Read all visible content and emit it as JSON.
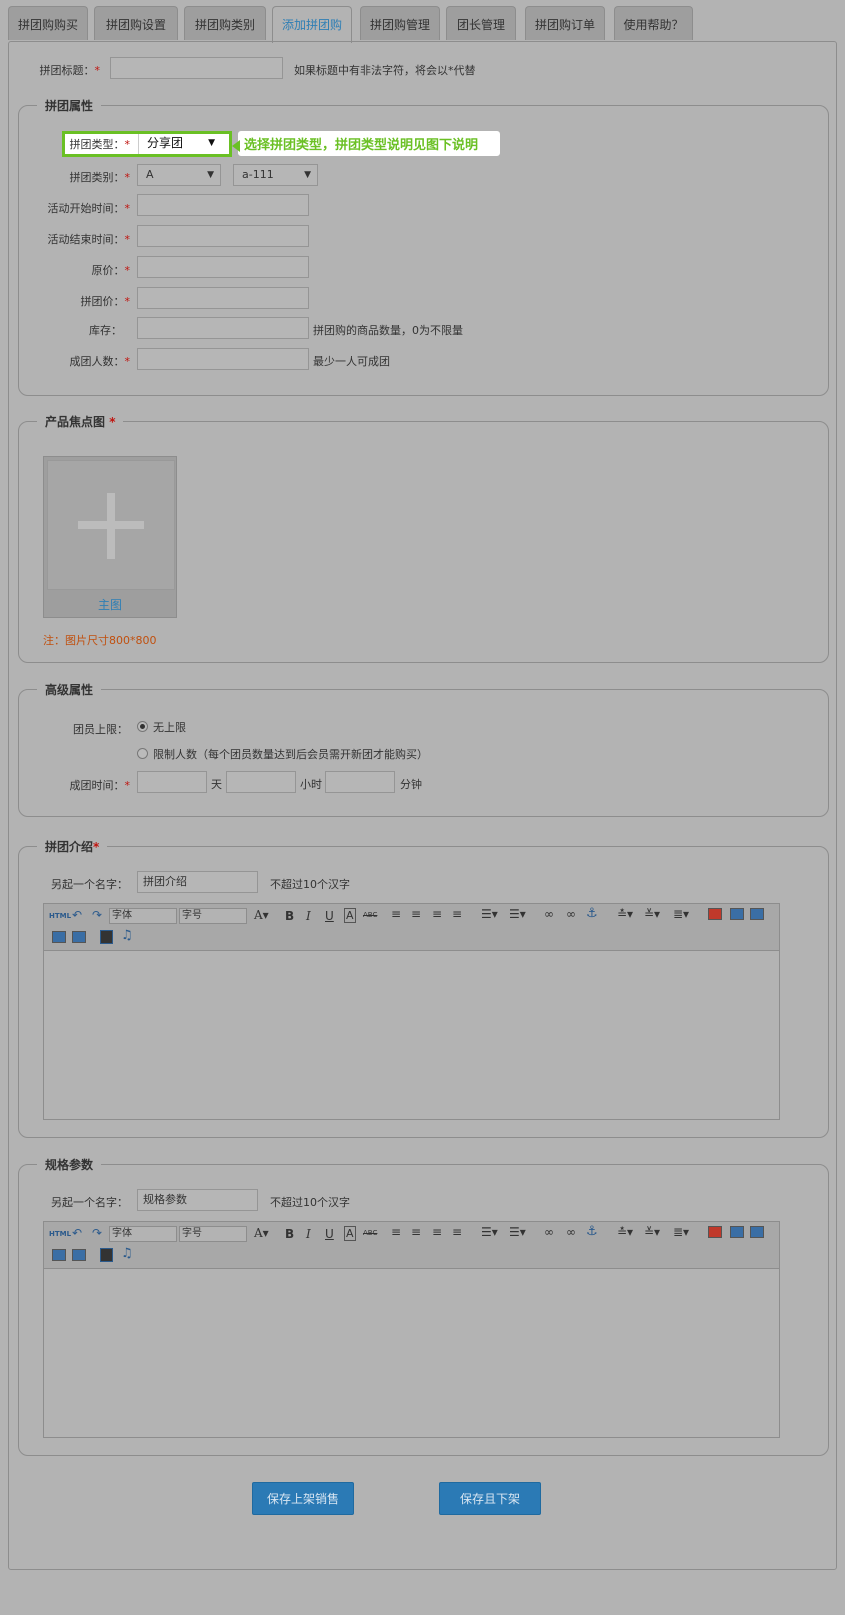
{
  "tabs": [
    "拼团购购买",
    "拼团购设置",
    "拼团购类别",
    "添加拼团购",
    "拼团购管理",
    "团长管理",
    "拼团购订单",
    "使用帮助？"
  ],
  "title_field": {
    "label": "拼团标题：",
    "required_mark": "*",
    "value": "",
    "hint": "如果标题中有非法字符，将会以*代替"
  },
  "section_attr": {
    "legend": "拼团属性",
    "type_label": "拼团类型：",
    "type_value": "分享团",
    "tip": "选择拼团类型，拼团类型说明见图下说明",
    "category_label": "拼团类别：",
    "category_value1": "A",
    "category_value2": "a-111",
    "start_label": "活动开始时间：",
    "end_label": "活动结束时间：",
    "price_label": "原价：",
    "group_price_label": "拼团价：",
    "stock_label": "库存：",
    "stock_hint": "拼团购的商品数量，0为不限量",
    "size_label": "成团人数：",
    "size_hint": "最少一人可成团",
    "required_mark": "*"
  },
  "section_image": {
    "legend": "产品焦点图",
    "required_mark": "*",
    "upload_caption": "主图",
    "note": "注：图片尺寸800*800"
  },
  "section_adv": {
    "legend": "高级属性",
    "limit_label": "团员上限：",
    "option_unlimited": "无上限",
    "option_limited": "限制人数（每个团员数量达到后会员需开新团才能购买）",
    "time_label": "成团时间：",
    "required_mark": "*",
    "unit_day": "天",
    "unit_hour": "小时",
    "unit_minute": "分钟"
  },
  "section_intro": {
    "legend": "拼团介绍",
    "required_mark": "*",
    "alias_label": "另起一个名字：",
    "alias_value": "拼团介绍",
    "alias_hint": "不超过10个汉字"
  },
  "section_spec": {
    "legend": "规格参数",
    "alias_label": "另起一个名字：",
    "alias_value": "规格参数",
    "alias_hint": "不超过10个汉字"
  },
  "editor": {
    "html": "HTML",
    "font": "字体",
    "size": "字号"
  },
  "buttons": {
    "save_publish": "保存上架销售",
    "save_unpublish": "保存且下架"
  }
}
